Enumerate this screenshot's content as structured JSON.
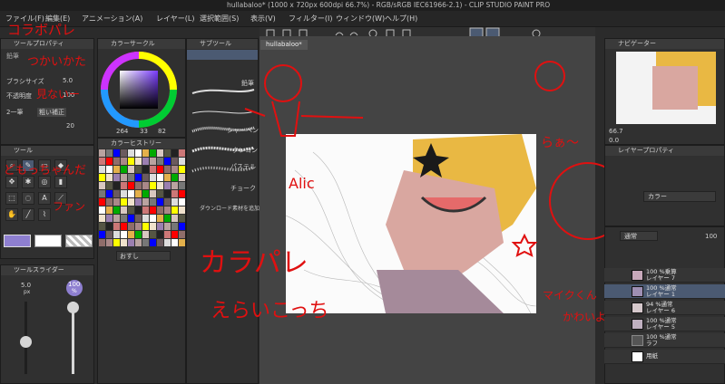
{
  "window": {
    "title": "hullabaloo* (1000 x 720px 600dpi 66.7%)  - RGB/sRGB IEC61966-2.1) - CLIP STUDIO PAINT PRO"
  },
  "menu": [
    {
      "label": "ファイル(F)"
    },
    {
      "label": "編集(E)"
    },
    {
      "label": "アニメーション(A)"
    },
    {
      "label": "レイヤー(L)"
    },
    {
      "label": "選択範囲(S)"
    },
    {
      "label": "表示(V)"
    },
    {
      "label": "フィルター(I)"
    },
    {
      "label": "ウィンドウ(W)"
    },
    {
      "label": "ヘルプ(H)"
    }
  ],
  "document_tab": {
    "label": "hullabaloo*"
  },
  "tool_property": {
    "title": "ツールプロパティ",
    "brush_size_label": "ブラシサイズ",
    "brush_size_value": "5.0",
    "opacity_label": "不透明度",
    "opacity_value": "100",
    "stabilize_value": "20",
    "aa_label": "2一筆",
    "aa_extra": "粗い補正"
  },
  "color_circle": {
    "title": "カラーサークル",
    "h": "264",
    "s": "33",
    "v": "82"
  },
  "sub_tool": {
    "title": "サブツール",
    "pencil_tab": "鉛筆",
    "items": [
      "鉛筆",
      "シャーペン",
      "クレヨン",
      "パステル",
      "チョーク"
    ],
    "download": "ダウンロード素材を追加する"
  },
  "color_history": {
    "title": "カラーヒストリー",
    "dropdown": "おすし"
  },
  "tool_panel": {
    "title": "ツール"
  },
  "tool_slider": {
    "title": "ツールスライダー",
    "size_value": "5.0",
    "size_unit": "px",
    "opacity_value": "100",
    "opacity_unit": "%"
  },
  "navigator": {
    "title": "ナビゲーター",
    "zoom": "66.7",
    "rotate": "0.0"
  },
  "layer_property": {
    "title": "レイヤープロパティ",
    "color_mode": "カラー"
  },
  "layer_panel": {
    "blend_mode": "通常",
    "opacity": "100",
    "layers": [
      {
        "mode": "100 %乗算",
        "name": "レイヤー 7",
        "selected": false
      },
      {
        "mode": "100 %通常",
        "name": "レイヤー 1",
        "selected": true
      },
      {
        "mode": "94 %通常",
        "name": "レイヤー 6",
        "selected": false
      },
      {
        "mode": "100 %通常",
        "name": "レイヤー 5",
        "selected": false
      },
      {
        "mode": "100 %通常",
        "name": "ラフ",
        "selected": false
      },
      {
        "mode": "",
        "name": "用紙",
        "selected": false
      }
    ]
  },
  "annotations": {
    "top_left": "コラボパレ",
    "tp_note1": "つかいかた",
    "tp_note2": "見ないー",
    "tool_note1": "どもっちゃんだ",
    "tool_note2": "ファン",
    "center_big": "カラパレ",
    "center_small": "えらいこっち",
    "clown_label": "Alic",
    "right_top": "らぁ〜",
    "right_bottom1": "マイクくん",
    "right_bottom2": "かわいよぼい"
  },
  "colors": {
    "accent_blue": "#4b5a72",
    "primary_color": "#8e7fd0",
    "secondary_color": "#ffffff",
    "annotation_red": "#e01010"
  }
}
